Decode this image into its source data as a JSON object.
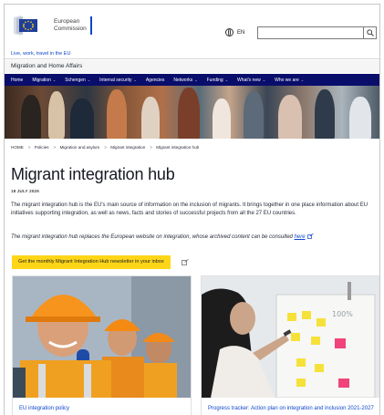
{
  "header": {
    "logo_line1": "European",
    "logo_line2": "Commission",
    "language": "EN",
    "search_placeholder": ""
  },
  "tagline": "Live, work, travel in the EU",
  "site_name": "Migration and Home Affairs",
  "nav": {
    "items": [
      {
        "label": "Home",
        "has_menu": false
      },
      {
        "label": "Migration",
        "has_menu": true
      },
      {
        "label": "Schengen",
        "has_menu": true
      },
      {
        "label": "Internal security",
        "has_menu": true
      },
      {
        "label": "Agencies",
        "has_menu": false
      },
      {
        "label": "Networks",
        "has_menu": true
      },
      {
        "label": "Funding",
        "has_menu": true
      },
      {
        "label": "What's new",
        "has_menu": true
      },
      {
        "label": "Who we are",
        "has_menu": true
      }
    ],
    "chevron": "⌄"
  },
  "breadcrumb": [
    "HOME",
    "Policies",
    "Migration and asylum",
    "Migrant integration",
    "Migrant integration hub"
  ],
  "breadcrumb_separator": ">",
  "page": {
    "title": "Migrant integration hub",
    "date": "18 JULY 2025",
    "intro": "The migrant integration hub is the EU's main source of information on the inclusion of migrants. It brings together in one place information about EU initiatives supporting integration, as well as news, facts and stories of successful projects from all the 27 EU countries.",
    "note_text": "The migrant integration hub replaces the European website on integration, whose archived content can be consulted ",
    "note_link": "here",
    "cta_label": "Get the monthly Migrant Integration Hub newsletter in your inbox"
  },
  "cards": [
    {
      "title": "EU integration policy"
    },
    {
      "title": "Progress tracker: Action plan on integration and inclusion 2021-2027"
    }
  ],
  "colors": {
    "nav_bg": "#0a0e6b",
    "cta_bg": "#ffd617",
    "link": "#0e47cb",
    "brand_blue": "#0e47cb"
  },
  "icons": {
    "globe": "globe-icon",
    "search": "search-icon",
    "external_link": "external-link-icon"
  }
}
